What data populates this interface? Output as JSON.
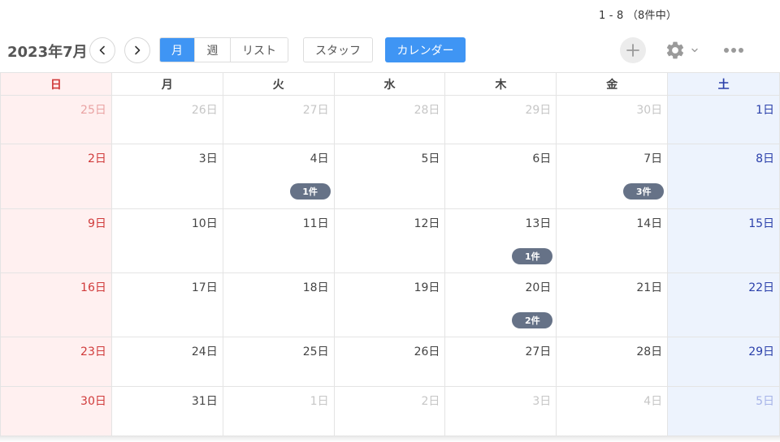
{
  "pager": {
    "count_text": "1 - 8 （8件中）"
  },
  "header": {
    "month_title": "2023年7月",
    "view_month": "月",
    "view_week": "週",
    "view_list": "リスト",
    "staff_button": "スタッフ",
    "calendar_button": "カレンダー"
  },
  "weekdays": [
    "日",
    "月",
    "火",
    "水",
    "木",
    "金",
    "土"
  ],
  "weeks": [
    [
      {
        "label": "25日",
        "other": true
      },
      {
        "label": "26日",
        "other": true
      },
      {
        "label": "27日",
        "other": true
      },
      {
        "label": "28日",
        "other": true
      },
      {
        "label": "29日",
        "other": true
      },
      {
        "label": "30日",
        "other": true
      },
      {
        "label": "1日",
        "other": false
      }
    ],
    [
      {
        "label": "2日",
        "other": false
      },
      {
        "label": "3日",
        "other": false
      },
      {
        "label": "4日",
        "other": false,
        "badge": "1件"
      },
      {
        "label": "5日",
        "other": false
      },
      {
        "label": "6日",
        "other": false
      },
      {
        "label": "7日",
        "other": false,
        "badge": "3件"
      },
      {
        "label": "8日",
        "other": false
      }
    ],
    [
      {
        "label": "9日",
        "other": false
      },
      {
        "label": "10日",
        "other": false
      },
      {
        "label": "11日",
        "other": false
      },
      {
        "label": "12日",
        "other": false
      },
      {
        "label": "13日",
        "other": false,
        "badge": "1件"
      },
      {
        "label": "14日",
        "other": false
      },
      {
        "label": "15日",
        "other": false
      }
    ],
    [
      {
        "label": "16日",
        "other": false
      },
      {
        "label": "17日",
        "other": false
      },
      {
        "label": "18日",
        "other": false
      },
      {
        "label": "19日",
        "other": false
      },
      {
        "label": "20日",
        "other": false,
        "badge": "2件"
      },
      {
        "label": "21日",
        "other": false
      },
      {
        "label": "22日",
        "other": false
      }
    ],
    [
      {
        "label": "23日",
        "other": false
      },
      {
        "label": "24日",
        "other": false
      },
      {
        "label": "25日",
        "other": false
      },
      {
        "label": "26日",
        "other": false
      },
      {
        "label": "27日",
        "other": false
      },
      {
        "label": "28日",
        "other": false
      },
      {
        "label": "29日",
        "other": false
      }
    ],
    [
      {
        "label": "30日",
        "other": false
      },
      {
        "label": "31日",
        "other": false
      },
      {
        "label": "1日",
        "other": true
      },
      {
        "label": "2日",
        "other": true
      },
      {
        "label": "3日",
        "other": true
      },
      {
        "label": "4日",
        "other": true
      },
      {
        "label": "5日",
        "other": true
      }
    ]
  ],
  "colors": {
    "accent": "#3f95f4",
    "sunday": "#d03a3a",
    "saturday": "#2a3faa",
    "badge": "#667287"
  },
  "icons": {
    "prev": "chevron-left-icon",
    "next": "chevron-right-icon",
    "add": "plus-icon",
    "settings": "gear-icon",
    "more": "ellipsis-icon"
  }
}
